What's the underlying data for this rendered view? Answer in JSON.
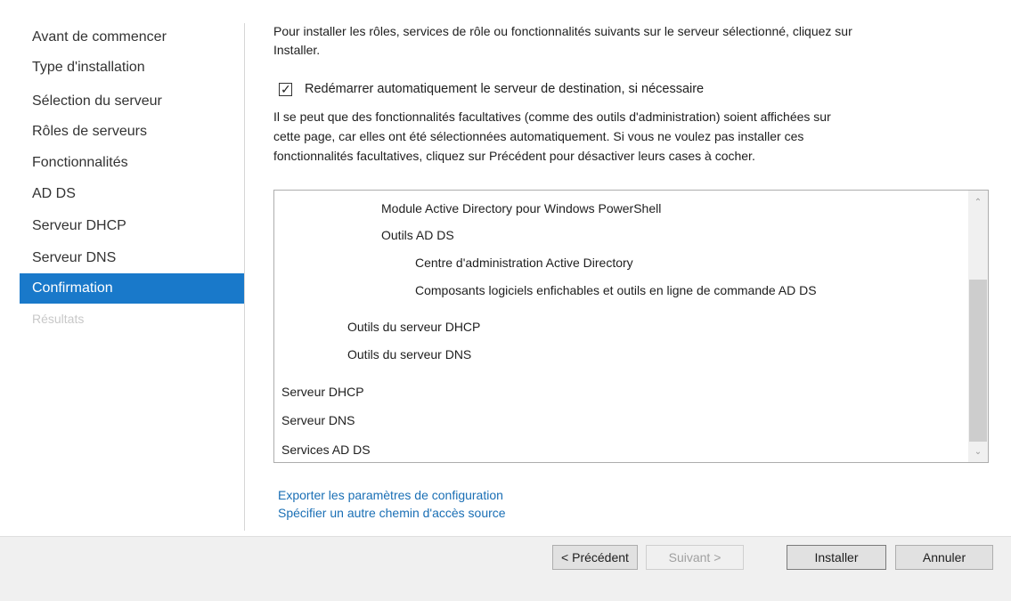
{
  "sidebar": {
    "items": [
      {
        "label": "Avant de commencer"
      },
      {
        "label": "Type d'installation"
      },
      {
        "label": "Sélection du serveur"
      },
      {
        "label": "Rôles de serveurs"
      },
      {
        "label": "Fonctionnalités"
      },
      {
        "label": "AD DS"
      },
      {
        "label": "Serveur DHCP"
      },
      {
        "label": "Serveur DNS"
      },
      {
        "label": "Confirmation",
        "state": "selected"
      },
      {
        "label": "Résultats",
        "state": "disabled"
      }
    ]
  },
  "main": {
    "intro_line1": "Pour installer les rôles, services de rôle ou fonctionnalités suivants sur le serveur sélectionné, cliquez sur",
    "intro_line2": "Installer.",
    "restart_checkbox": {
      "label": "Redémarrer automatiquement le serveur de destination, si nécessaire",
      "checked": true
    },
    "info_line1": "Il se peut que des fonctionnalités facultatives (comme des outils d'administration) soient affichées sur",
    "info_line2": "cette page, car elles ont été sélectionnées automatiquement. Si vous ne voulez pas installer ces",
    "info_line3": "fonctionnalités facultatives, cliquez sur Précédent pour désactiver leurs cases à cocher.",
    "features": [
      {
        "label": "Module Active Directory pour Windows PowerShell",
        "level": 3
      },
      {
        "label": "Outils AD DS",
        "level": 3
      },
      {
        "label": "Centre d'administration Active Directory",
        "level": 4
      },
      {
        "label": "Composants logiciels enfichables et outils en ligne de commande AD DS",
        "level": 4
      },
      {
        "label": "Outils du serveur DHCP",
        "level": 2
      },
      {
        "label": "Outils du serveur DNS",
        "level": 2
      },
      {
        "label": "Serveur DHCP",
        "level": 0
      },
      {
        "label": "Serveur DNS",
        "level": 0
      },
      {
        "label": "Services AD DS",
        "level": 0
      }
    ],
    "scroll_up_icon": "chevron-up",
    "scroll_down_icon": "chevron-down",
    "export_link": "Exporter les paramètres de configuration",
    "source_link": "Spécifier un autre chemin d'accès source"
  },
  "footer": {
    "previous": "< Précédent",
    "next": "Suivant >",
    "install": "Installer",
    "cancel": "Annuler"
  }
}
